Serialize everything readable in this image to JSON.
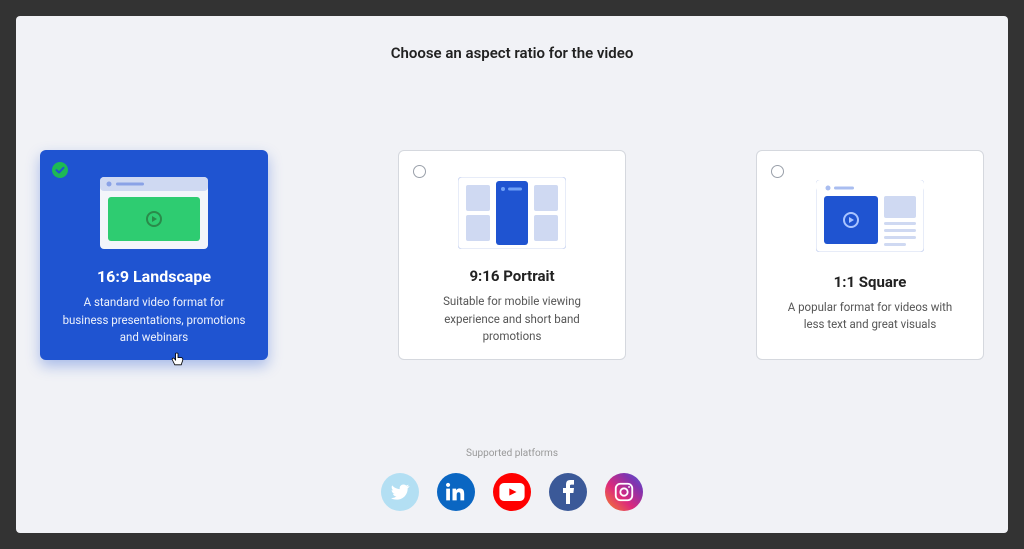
{
  "title": "Choose an aspect ratio for the video",
  "options": [
    {
      "id": "landscape",
      "title": "16:9 Landscape",
      "description": "A standard video format for business presentations, promotions and webinars",
      "selected": true
    },
    {
      "id": "portrait",
      "title": "9:16 Portrait",
      "description": "Suitable for mobile viewing experience and short band promotions",
      "selected": false
    },
    {
      "id": "square",
      "title": "1:1 Square",
      "description": "A popular format for videos with less text and great visuals",
      "selected": false
    }
  ],
  "supported_label": "Supported platforms",
  "platforms": [
    "twitter",
    "linkedin",
    "youtube",
    "facebook",
    "instagram"
  ],
  "colors": {
    "accent": "#1f54d1",
    "panel_bg": "#f1f2f6",
    "outer_bg": "#333333"
  }
}
